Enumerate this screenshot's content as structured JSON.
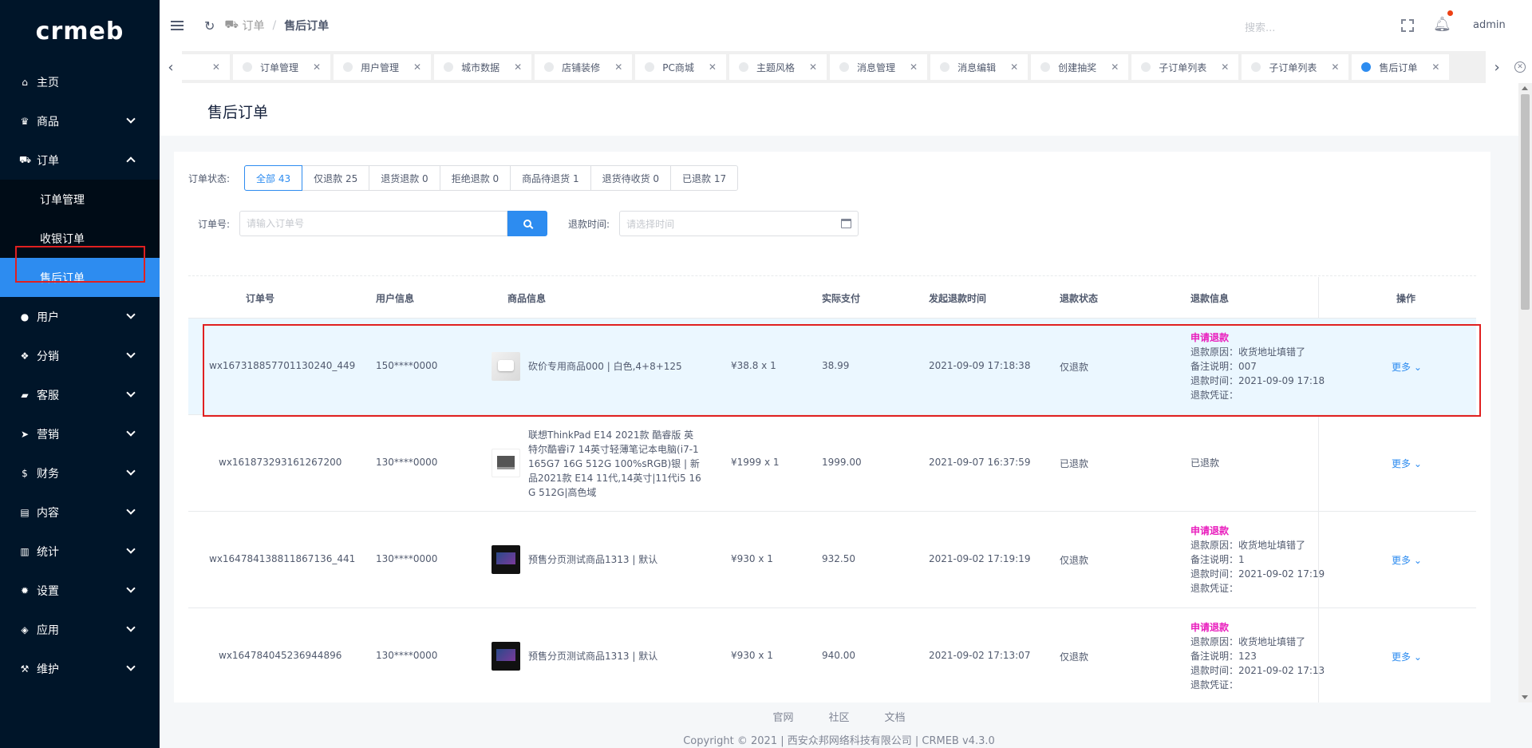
{
  "brand": {
    "logo": "crmeb"
  },
  "sidebar": {
    "items": [
      {
        "label": "主页",
        "icon": "home-icon",
        "glyph": "⌂"
      },
      {
        "label": "商品",
        "icon": "shop-icon",
        "glyph": "♛"
      },
      {
        "label": "订单",
        "icon": "cart-icon",
        "glyph": "⛟"
      },
      {
        "label": "用户",
        "icon": "user-icon",
        "glyph": "●"
      },
      {
        "label": "分销",
        "icon": "distribution-icon",
        "glyph": "❖"
      },
      {
        "label": "客服",
        "icon": "chat-icon",
        "glyph": "▰"
      },
      {
        "label": "营销",
        "icon": "send-icon",
        "glyph": "➤"
      },
      {
        "label": "财务",
        "icon": "dollar-icon",
        "glyph": "$"
      },
      {
        "label": "内容",
        "icon": "book-icon",
        "glyph": "▤"
      },
      {
        "label": "统计",
        "icon": "chart-icon",
        "glyph": "▥"
      },
      {
        "label": "设置",
        "icon": "gear-icon",
        "glyph": "✹"
      },
      {
        "label": "应用",
        "icon": "cube-icon",
        "glyph": "◈"
      },
      {
        "label": "维护",
        "icon": "hammer-icon",
        "glyph": "⚒"
      }
    ],
    "order_sub": [
      "订单管理",
      "收银订单",
      "售后订单"
    ]
  },
  "header": {
    "breadcrumb_parent": "订单",
    "breadcrumb_sep": "/",
    "breadcrumb_current": "售后订单",
    "search_placeholder": "搜索...",
    "user": "admin"
  },
  "tabs": [
    "订单管理",
    "用户管理",
    "城市数据",
    "店铺装修",
    "PC商城",
    "主题风格",
    "消息管理",
    "消息编辑",
    "创建抽奖",
    "子订单列表",
    "子订单列表",
    "售后订单"
  ],
  "page": {
    "title": "售后订单"
  },
  "filter": {
    "label": "订单状态:",
    "options": [
      "全部 43",
      "仅退款 25",
      "退货退款 0",
      "拒绝退款 0",
      "商品待退货 1",
      "退货待收货 0",
      "已退款 17"
    ]
  },
  "search": {
    "order_label": "订单号:",
    "order_placeholder": "请输入订单号",
    "time_label": "退款时间:",
    "time_placeholder": "请选择时间"
  },
  "table": {
    "headers": {
      "order_no": "订单号",
      "user": "用户信息",
      "product": "商品信息",
      "paid": "实际支付",
      "refund_time": "发起退款时间",
      "status": "退款状态",
      "refund_info": "退款信息",
      "ops": "操作"
    },
    "more_label": "更多",
    "rows": [
      {
        "order_no": "wx167318857701130240_449",
        "user": "150****0000",
        "product_lines": [
          "砍价专用商品000 | 白色,4+8+125"
        ],
        "price": "¥38.8 x 1",
        "paid": "38.99",
        "refund_time": "2021-09-09 17:18:38",
        "status": "仅退款",
        "info_title": "申请退款",
        "info_lines": [
          "退款原因：收货地址填错了",
          "备注说明：007",
          "退款时间：2021-09-09 17:18",
          "退款凭证："
        ]
      },
      {
        "order_no": "wx161873293161267200",
        "user": "130****0000",
        "product_lines": [
          "联想ThinkPad E14 2021款 酷睿版 英",
          "特尔酷睿i7 14英寸轻薄笔记本电脑(i7-1",
          "165G7 16G 512G 100%sRGB)银 | 新",
          "品2021款 E14 11代,14英寸|11代i5 16",
          "G 512G|高色域"
        ],
        "price": "¥1999 x 1",
        "paid": "1999.00",
        "refund_time": "2021-09-07 16:37:59",
        "status": "已退款",
        "info_title": "",
        "info_lines": [
          "已退款"
        ]
      },
      {
        "order_no": "wx164784138811867136_441",
        "user": "130****0000",
        "product_lines": [
          "预售分页测试商品1313 | 默认"
        ],
        "price": "¥930 x 1",
        "paid": "932.50",
        "refund_time": "2021-09-02 17:19:19",
        "status": "仅退款",
        "info_title": "申请退款",
        "info_lines": [
          "退款原因：收货地址填错了",
          "备注说明：1",
          "退款时间：2021-09-02 17:19",
          "退款凭证："
        ]
      },
      {
        "order_no": "wx164784045236944896",
        "user": "130****0000",
        "product_lines": [
          "预售分页测试商品1313 | 默认"
        ],
        "price": "¥930 x 1",
        "paid": "940.00",
        "refund_time": "2021-09-02 17:13:07",
        "status": "仅退款",
        "info_title": "申请退款",
        "info_lines": [
          "退款原因：收货地址填错了",
          "备注说明：123",
          "退款时间：2021-09-02 17:13",
          "退款凭证："
        ]
      }
    ]
  },
  "footer": {
    "links": [
      "官网",
      "社区",
      "文档"
    ],
    "copyright": "Copyright © 2021 | 西安众邦网络科技有限公司 | CRMEB v4.3.0"
  },
  "colors": {
    "primary": "#2d8cf0",
    "sidebar": "#001529",
    "refund_apply": "#e91ebd",
    "highlight": "#e02020"
  }
}
